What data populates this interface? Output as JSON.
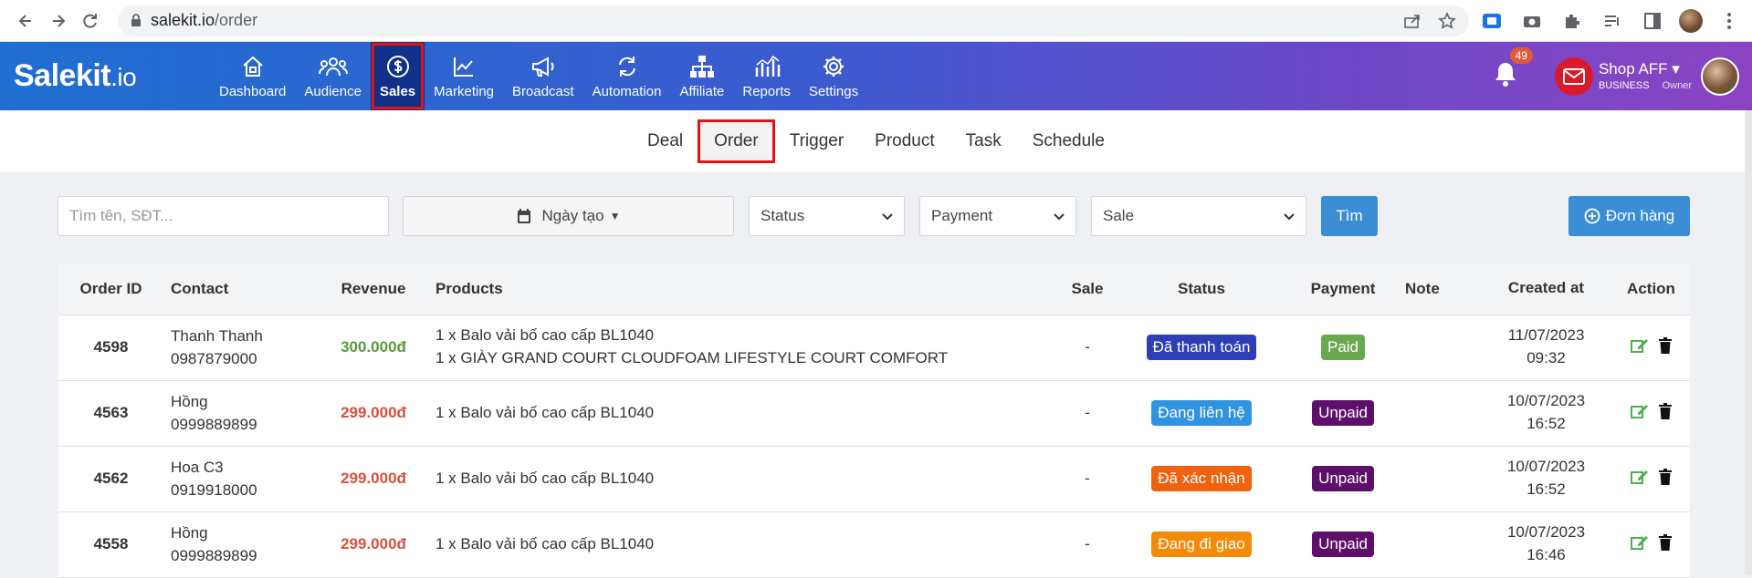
{
  "browser": {
    "url_host": "salekit.io",
    "url_path": "/order"
  },
  "app": {
    "logo_main": "Salekit",
    "logo_suffix": ".io",
    "nav": [
      {
        "label": "Dashboard",
        "icon": "house-icon"
      },
      {
        "label": "Audience",
        "icon": "users-icon"
      },
      {
        "label": "Sales",
        "icon": "dollar-icon",
        "active": true
      },
      {
        "label": "Marketing",
        "icon": "chart-line-icon"
      },
      {
        "label": "Broadcast",
        "icon": "megaphone-icon"
      },
      {
        "label": "Automation",
        "icon": "cycle-icon"
      },
      {
        "label": "Affiliate",
        "icon": "sitemap-icon"
      },
      {
        "label": "Reports",
        "icon": "bar-chart-icon"
      },
      {
        "label": "Settings",
        "icon": "gear-icon"
      }
    ],
    "notifications": "49",
    "shop_name": "Shop AFF",
    "plan": "BUSINESS",
    "role": "Owner"
  },
  "subtabs": [
    {
      "label": "Deal"
    },
    {
      "label": "Order",
      "active": true
    },
    {
      "label": "Trigger"
    },
    {
      "label": "Product"
    },
    {
      "label": "Task"
    },
    {
      "label": "Schedule"
    }
  ],
  "filters": {
    "search_placeholder": "Tìm tên, SĐT...",
    "date_label": "Ngày tạo",
    "status_label": "Status",
    "payment_label": "Payment",
    "sale_label": "Sale",
    "find_button": "Tìm",
    "new_order_button": "Đơn hàng"
  },
  "table": {
    "headers": {
      "id": "Order ID",
      "contact": "Contact",
      "revenue": "Revenue",
      "products": "Products",
      "sale": "Sale",
      "status": "Status",
      "payment": "Payment",
      "note": "Note",
      "created": "Created at",
      "action": "Action"
    },
    "rows": [
      {
        "id": "4598",
        "name": "Thanh Thanh",
        "phone": "0987879000",
        "revenue": "300.000đ",
        "product1": "1 x Balo vải bố cao cấp BL1040",
        "product2": "1 x GIÀY GRAND COURT CLOUDFOAM LIFESTYLE COURT COMFORT",
        "sale": "-",
        "status": "Đã thanh toán",
        "payment": "Paid",
        "date": "11/07/2023",
        "time": "09:32"
      },
      {
        "id": "4563",
        "name": "Hồng",
        "phone": "0999889899",
        "revenue": "299.000đ",
        "product1": "1 x Balo vải bố cao cấp BL1040",
        "product2": "",
        "sale": "-",
        "status": "Đang liên hệ",
        "payment": "Unpaid",
        "date": "10/07/2023",
        "time": "16:52"
      },
      {
        "id": "4562",
        "name": "Hoa C3",
        "phone": "0919918000",
        "revenue": "299.000đ",
        "product1": "1 x Balo vải bố cao cấp BL1040",
        "product2": "",
        "sale": "-",
        "status": "Đã xác nhận",
        "payment": "Unpaid",
        "date": "10/07/2023",
        "time": "16:52"
      },
      {
        "id": "4558",
        "name": "Hồng",
        "phone": "0999889899",
        "revenue": "299.000đ",
        "product1": "1 x Balo vải bố cao cấp BL1040",
        "product2": "",
        "sale": "-",
        "status": "Đang đi giao",
        "payment": "Unpaid",
        "date": "10/07/2023",
        "time": "16:46"
      }
    ]
  },
  "colors": {
    "status_paid": "#2e3fb5",
    "status_contacting": "#2f93e0",
    "status_confirmed": "#f0620f",
    "status_shipping": "#f48a0a",
    "payment_paid": "#6aa84f",
    "payment_unpaid": "#5d0f6b",
    "primary": "#3b8ed6"
  }
}
